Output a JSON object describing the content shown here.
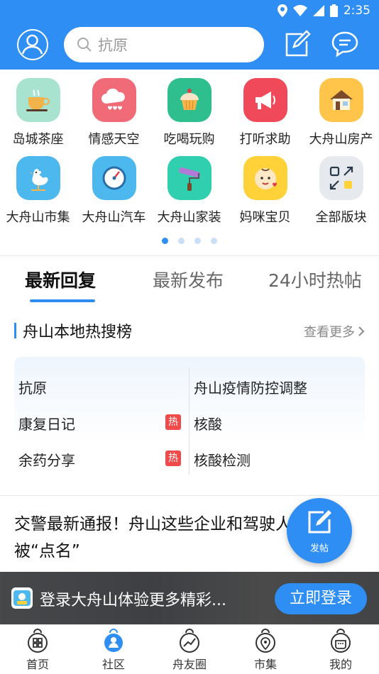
{
  "status_bar": {
    "time": "2:35"
  },
  "header": {
    "search_placeholder": "抗原",
    "icons": [
      "user-icon",
      "search-icon",
      "edit-icon",
      "message-icon"
    ]
  },
  "categories": [
    {
      "label": "岛城茶座",
      "icon": "tea-cup-icon",
      "color": "#9fe0c9"
    },
    {
      "label": "情感天空",
      "icon": "heart-cloud-icon",
      "color": "#f06a78"
    },
    {
      "label": "吃喝玩购",
      "icon": "cupcake-icon",
      "color": "#2fbf8f"
    },
    {
      "label": "打听求助",
      "icon": "megaphone-icon",
      "color": "#f04a5a"
    },
    {
      "label": "大舟山房产",
      "icon": "house-icon",
      "color": "#ffc44a"
    },
    {
      "label": "大舟山市集",
      "icon": "rooster-icon",
      "color": "#4cb8ee"
    },
    {
      "label": "大舟山汽车",
      "icon": "speedometer-icon",
      "color": "#4cb8ee"
    },
    {
      "label": "大舟山家装",
      "icon": "paint-roller-icon",
      "color": "#2fcfb0"
    },
    {
      "label": "妈咪宝贝",
      "icon": "baby-icon",
      "color": "#ffd23a"
    },
    {
      "label": "全部版块",
      "icon": "grid-arrows-icon",
      "color": "#e6eaef"
    }
  ],
  "pager": {
    "count": 4,
    "active": 0
  },
  "tabs": [
    {
      "label": "最新回复",
      "active": true
    },
    {
      "label": "最新发布",
      "active": false
    },
    {
      "label": "24小时热帖",
      "active": false
    }
  ],
  "hot_search": {
    "title": "舟山本地热搜榜",
    "more": "查看更多",
    "left": [
      {
        "text": "抗原",
        "badge": ""
      },
      {
        "text": "康复日记",
        "badge": "热"
      },
      {
        "text": "余药分享",
        "badge": "热"
      }
    ],
    "right": [
      {
        "text": "舟山疫情防控调整"
      },
      {
        "text": "核酸"
      },
      {
        "text": "核酸检测"
      }
    ]
  },
  "article": {
    "title": "交警最新通报！舟山这些企业和驾驶人被“点名”"
  },
  "fab": {
    "label": "发帖"
  },
  "login_banner": {
    "text": "登录大舟山体验更多精彩...",
    "button": "立即登录"
  },
  "bottom_nav": [
    {
      "label": "首页",
      "icon": "home-icon",
      "active": false
    },
    {
      "label": "社区",
      "icon": "community-icon",
      "active": true
    },
    {
      "label": "舟友圈",
      "icon": "trend-icon",
      "active": false
    },
    {
      "label": "市集",
      "icon": "location-icon",
      "active": false
    },
    {
      "label": "我的",
      "icon": "profile-icon",
      "active": false
    }
  ],
  "colors": {
    "primary": "#2f8ef3",
    "hot_badge": "#f04a4a"
  }
}
